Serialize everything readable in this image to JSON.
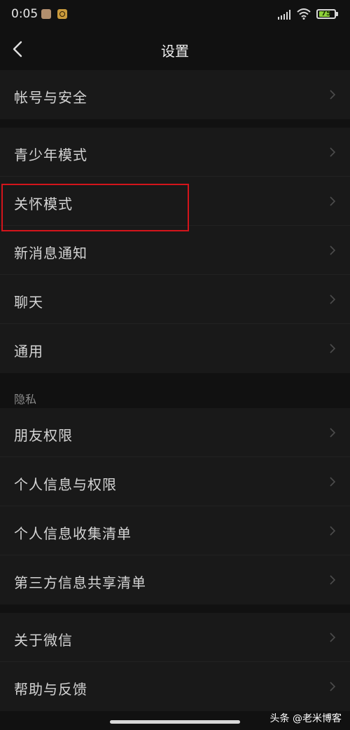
{
  "status_bar": {
    "time": "0:05",
    "battery_level": 75,
    "battery_text": "75"
  },
  "header": {
    "title": "设置"
  },
  "groups": [
    {
      "items": [
        {
          "label": "帐号与安全"
        }
      ]
    },
    {
      "items": [
        {
          "label": "青少年模式"
        },
        {
          "label": "关怀模式"
        },
        {
          "label": "新消息通知"
        },
        {
          "label": "聊天"
        },
        {
          "label": "通用"
        }
      ]
    },
    {
      "section_label": "隐私",
      "items": [
        {
          "label": "朋友权限"
        },
        {
          "label": "个人信息与权限"
        },
        {
          "label": "个人信息收集清单"
        },
        {
          "label": "第三方信息共享清单"
        }
      ]
    },
    {
      "items": [
        {
          "label": "关于微信"
        },
        {
          "label": "帮助与反馈"
        }
      ]
    }
  ],
  "watermark": {
    "text": "头条 @老米博客"
  },
  "colors": {
    "background": "#111111",
    "row_background": "#191919",
    "highlight": "#d3141b",
    "battery": "#8ed13a"
  },
  "icons": [
    "back-icon",
    "chevron-right-icon",
    "signal-icon",
    "wifi-icon",
    "battery-icon"
  ]
}
